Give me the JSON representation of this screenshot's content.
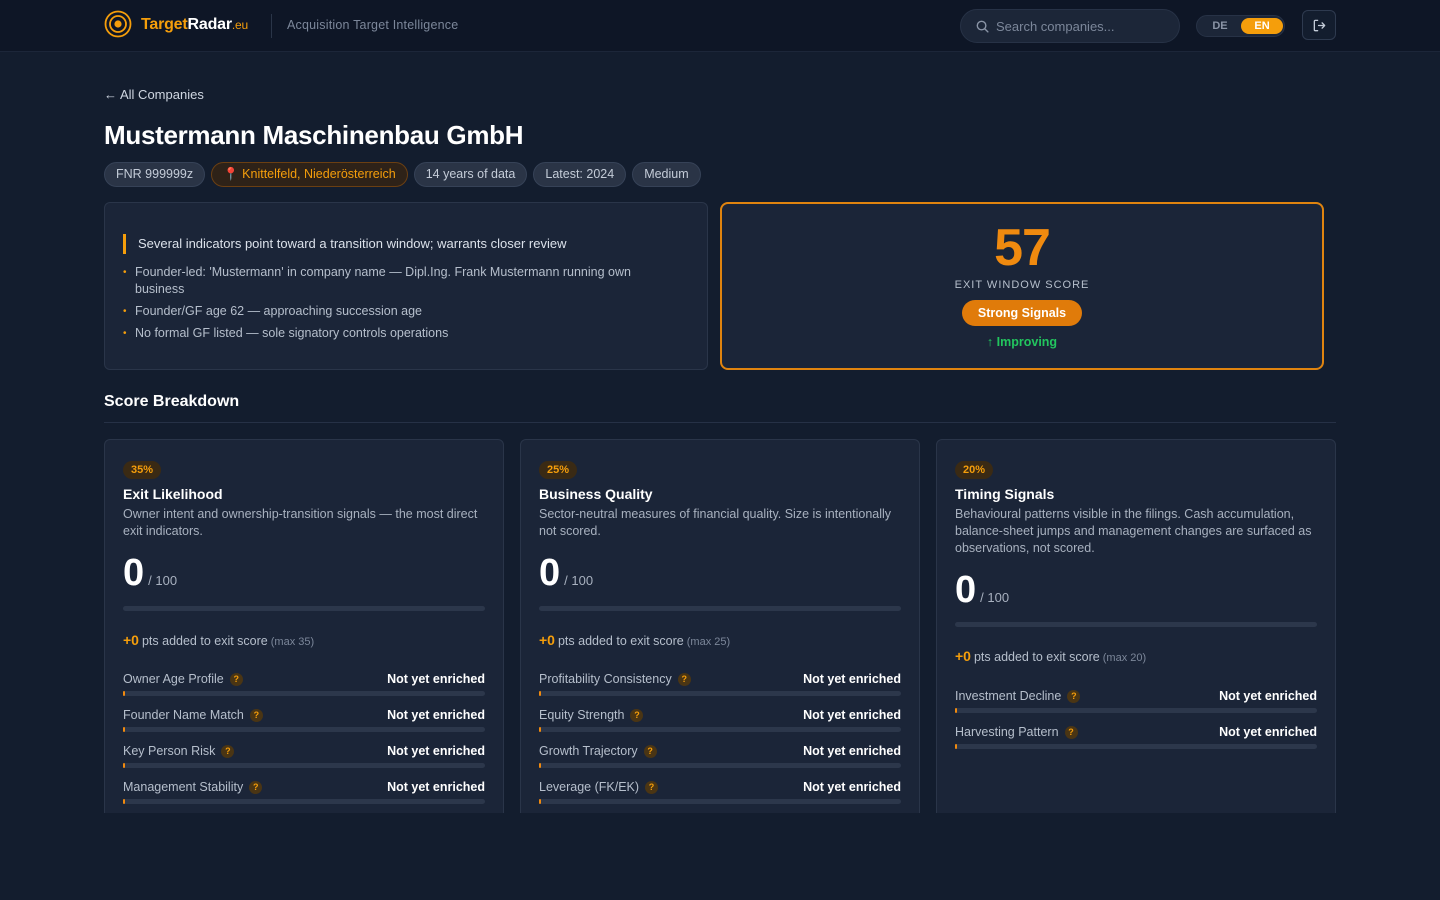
{
  "nav": {
    "brand_main": "Target",
    "brand_bold": "Radar",
    "brand_tld": ".eu",
    "tagline": "Acquisition Target Intelligence",
    "search_placeholder": "Search companies...",
    "lang_de": "DE",
    "lang_en": "EN",
    "active_lang": "EN",
    "icons": {
      "logo": "radar-target-icon",
      "search": "search-icon",
      "logout": "logout-icon"
    }
  },
  "header": {
    "back_label": "All Companies",
    "company_name": "Mustermann Maschinenbau GmbH",
    "chips": {
      "fnr": "FNR 999999z",
      "location": "📍 Knittelfeld, Niederösterreich",
      "years": "14 years of data",
      "latest": "Latest: 2024",
      "size": "Medium"
    }
  },
  "summary": {
    "headline": "Several indicators point toward a transition window; warrants closer review",
    "bullets": [
      "Founder-led: 'Mustermann' in company name — Dipl.Ing. Frank Mustermann running own business",
      "Founder/GF age 62 — approaching succession age",
      "No formal GF listed — sole signatory controls operations"
    ]
  },
  "score": {
    "value": "57",
    "label": "EXIT WINDOW SCORE",
    "badge": "Strong Signals",
    "trend": "↑ Improving"
  },
  "breakdown": {
    "title": "Score Breakdown",
    "cards": [
      {
        "weight": "35%",
        "title": "Exit Likelihood",
        "desc": "Owner intent and ownership-transition signals — the most direct exit indicators.",
        "score": "0",
        "of": "/ 100",
        "fill_fraction": 0,
        "pts": "+0",
        "pts_label": "pts added to exit score",
        "max": "(max 35)",
        "metrics": [
          {
            "name": "Owner Age Profile",
            "value": "Not yet enriched"
          },
          {
            "name": "Founder Name Match",
            "value": "Not yet enriched"
          },
          {
            "name": "Key Person Risk",
            "value": "Not yet enriched"
          },
          {
            "name": "Management Stability",
            "value": "Not yet enriched"
          }
        ]
      },
      {
        "weight": "25%",
        "title": "Business Quality",
        "desc": "Sector-neutral measures of financial quality. Size is intentionally not scored.",
        "score": "0",
        "of": "/ 100",
        "fill_fraction": 0,
        "pts": "+0",
        "pts_label": "pts added to exit score",
        "max": "(max 25)",
        "metrics": [
          {
            "name": "Profitability Consistency",
            "value": "Not yet enriched"
          },
          {
            "name": "Equity Strength",
            "value": "Not yet enriched"
          },
          {
            "name": "Growth Trajectory",
            "value": "Not yet enriched"
          },
          {
            "name": "Leverage (FK/EK)",
            "value": "Not yet enriched"
          }
        ]
      },
      {
        "weight": "20%",
        "title": "Timing Signals",
        "desc": "Behavioural patterns visible in the filings. Cash accumulation, balance-sheet jumps and management changes are surfaced as observations, not scored.",
        "score": "0",
        "of": "/ 100",
        "fill_fraction": 0,
        "pts": "+0",
        "pts_label": "pts added to exit score",
        "max": "(max 20)",
        "metrics": [
          {
            "name": "Investment Decline",
            "value": "Not yet enriched"
          },
          {
            "name": "Harvesting Pattern",
            "value": "Not yet enriched"
          }
        ]
      }
    ]
  },
  "colors": {
    "accent": "#f59e0b",
    "score_orange": "#f08a0f",
    "trend_green": "#22c55e",
    "background": "#131d2e",
    "card": "#1b2538"
  }
}
